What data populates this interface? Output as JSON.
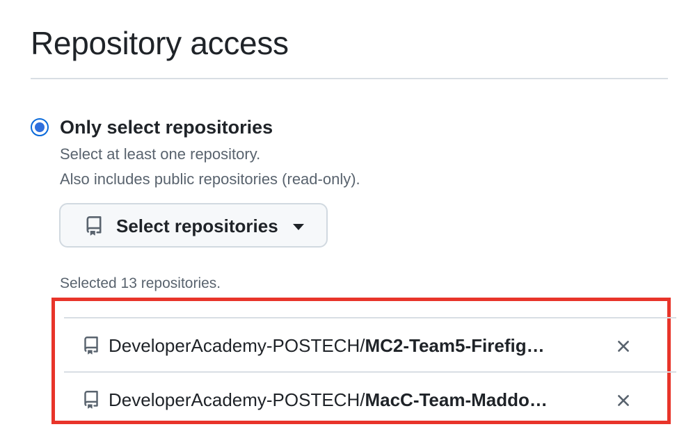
{
  "header": {
    "title": "Repository access"
  },
  "access_option": {
    "label": "Only select repositories",
    "selected": true,
    "hint_line_1": "Select at least one repository.",
    "hint_line_2": "Also includes public repositories (read-only)."
  },
  "select_button": {
    "label": "Select repositories",
    "icon": "repo-icon"
  },
  "selection": {
    "count_text": "Selected 13 repositories.",
    "items": [
      {
        "owner": "DeveloperAcademy-POSTECH/",
        "name": "MC2-Team5-Firefig…"
      },
      {
        "owner": "DeveloperAcademy-POSTECH/",
        "name": "MacC-Team-Maddo…"
      }
    ]
  },
  "colors": {
    "accent": "#0969da",
    "highlight_border": "#e8342a",
    "muted_text": "#59636e",
    "divider": "#d8dee4"
  }
}
